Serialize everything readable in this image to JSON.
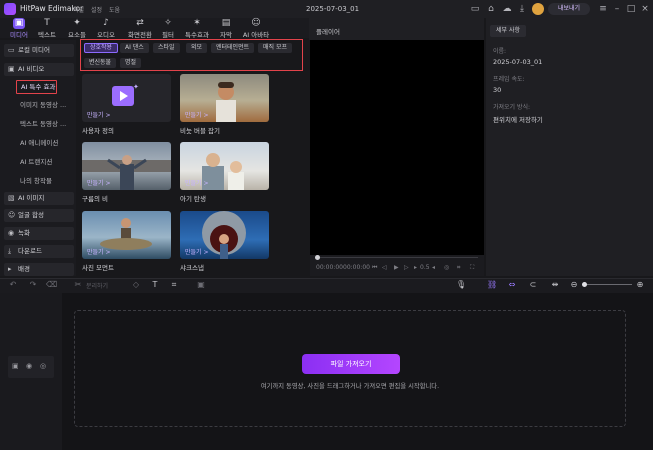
{
  "app": {
    "name": "HitPaw Edimakor",
    "menus": [
      "파일",
      "설정",
      "도움"
    ],
    "document_title": "2025-07-03_01",
    "export_label": "내보내기"
  },
  "toolbar": {
    "tabs": [
      {
        "label": "미디어",
        "icon": "media-icon"
      },
      {
        "label": "텍스트",
        "icon": "text-icon"
      },
      {
        "label": "요소들",
        "icon": "elements-icon"
      },
      {
        "label": "오디오",
        "icon": "audio-icon"
      },
      {
        "label": "화면전환",
        "icon": "transition-icon"
      },
      {
        "label": "필터",
        "icon": "filter-icon"
      },
      {
        "label": "특수효과",
        "icon": "effects-icon"
      },
      {
        "label": "자막",
        "icon": "subtitle-icon"
      },
      {
        "label": "AI 아바타",
        "icon": "avatar-icon"
      }
    ]
  },
  "sidebar": {
    "items": [
      {
        "label": "로컬 미디어"
      },
      {
        "label": "AI 비디오"
      },
      {
        "label": "AI 이미지"
      },
      {
        "label": "얼굴 합성"
      },
      {
        "label": "녹화"
      },
      {
        "label": "다운로드"
      },
      {
        "label": "배경"
      }
    ],
    "sub_items": [
      {
        "label": "AI 특수 효과"
      },
      {
        "label": "이미지 동영상 ..."
      },
      {
        "label": "텍스트 동영상 ..."
      },
      {
        "label": "AI 애니메이션"
      },
      {
        "label": "AI 트랜지션"
      },
      {
        "label": "나의 창작물"
      }
    ]
  },
  "categories": [
    "상호작용",
    "AI 댄스",
    "스타일",
    "외모",
    "엔터테인먼트",
    "매직 모프",
    "변신동물",
    "명절"
  ],
  "cards": [
    {
      "title": "사용자 정의",
      "make": "만들기 >"
    },
    {
      "title": "비눗 버블 잡기",
      "make": "만들기 >"
    },
    {
      "title": "구름의 비",
      "make": "만들기 >"
    },
    {
      "title": "아기 탄생",
      "make": "만들기 >"
    },
    {
      "title": "사진 모먼트",
      "make": "만들기 >"
    },
    {
      "title": "샤크스냅",
      "make": "만들기 >"
    }
  ],
  "player": {
    "title": "플레이어",
    "time_current": "00:00:00",
    "time_total": "00:00:00",
    "speed": "0.5"
  },
  "details": {
    "tab": "세부 사항",
    "name_label": "이름:",
    "name_value": "2025-07-03_01",
    "fps_label": "프레임 속도:",
    "fps_value": "30",
    "import_label": "가져오기 방식:",
    "import_value": "편위치에 저장하기"
  },
  "timeline_toolbar": {
    "split_label": "분리하기"
  },
  "timeline": {
    "import_button": "파일 가져오기",
    "hint": "여기까지 동영상, 사진을 드래그하거나 가져오면 편집을 시작합니다."
  },
  "colors": {
    "accent": "#7b55f5",
    "highlight_box": "#e2434b",
    "import_gradient_start": "#8b2ff3",
    "import_gradient_end": "#b446ff"
  }
}
